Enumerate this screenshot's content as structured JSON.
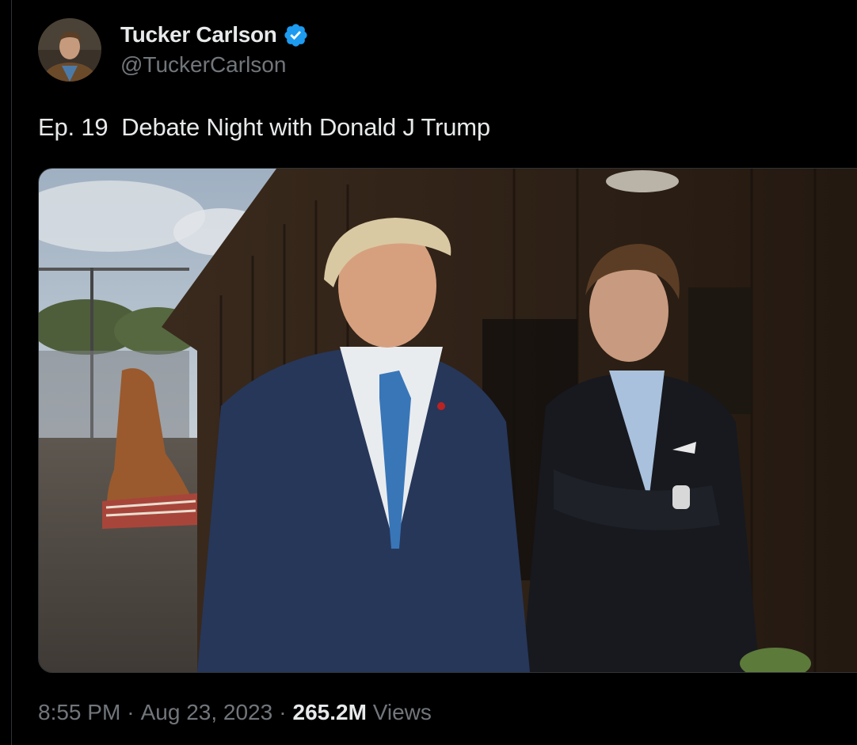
{
  "author": {
    "display_name": "Tucker Carlson",
    "handle": "@TuckerCarlson",
    "verified": true,
    "verified_color": "#1d9bf0"
  },
  "tweet": {
    "text": "Ep. 19  Debate Night with Donald J Trump"
  },
  "media": {
    "type": "video-thumbnail"
  },
  "meta": {
    "time": "8:55 PM",
    "separator": "·",
    "date": "Aug 23, 2023",
    "views_count": "265.2M",
    "views_label": "Views"
  },
  "colors": {
    "background": "#000000",
    "primary_text": "#e7e9ea",
    "secondary_text": "#71767b",
    "border": "#2f3336"
  }
}
